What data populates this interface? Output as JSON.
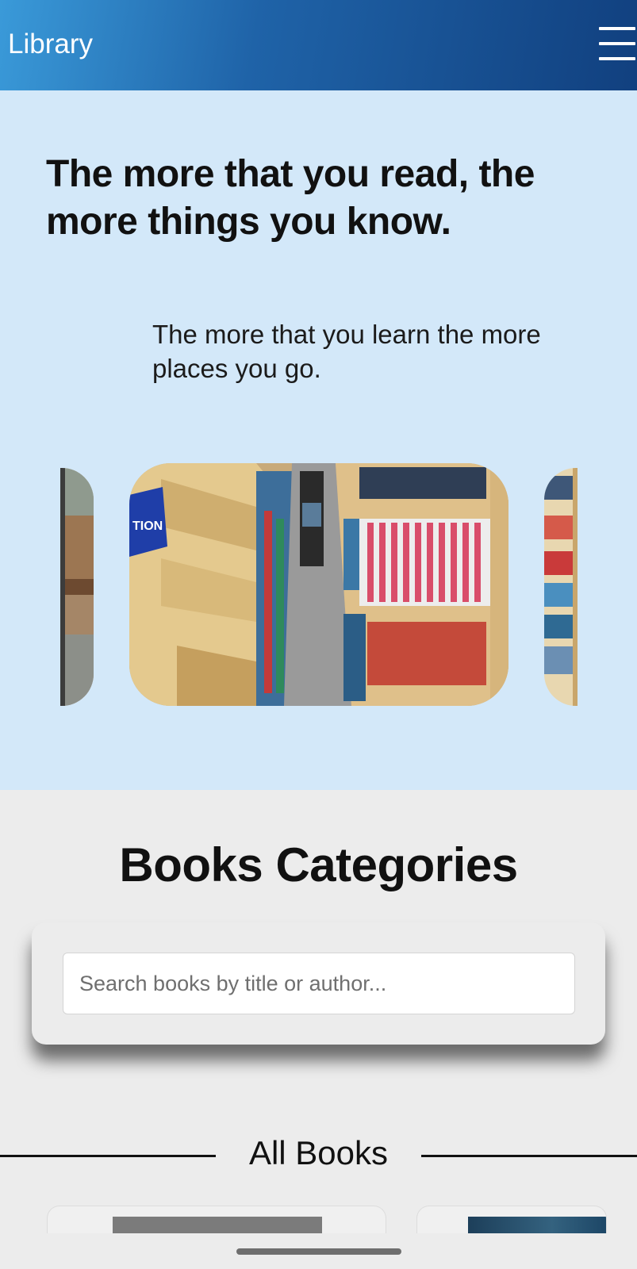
{
  "app": {
    "title": "Library"
  },
  "header": {
    "menu_icon": "hamburger-menu-icon"
  },
  "hero": {
    "headline": "The more that you read, the more things you know.",
    "subline": "The more that you learn the more places you go."
  },
  "carousel": {
    "slides": [
      {
        "position": "previous",
        "image": "library-interior-photo"
      },
      {
        "position": "current",
        "image": "bookshelf-aisle-photo",
        "sign_text": "TION"
      },
      {
        "position": "next",
        "image": "bookshelf-photo"
      }
    ]
  },
  "categories": {
    "title": "Books Categories",
    "search": {
      "placeholder": "Search books by title or author...",
      "value": ""
    }
  },
  "all_books": {
    "title": "All Books"
  },
  "colors": {
    "header_start": "#3a9ad9",
    "header_end": "#11407f",
    "hero_bg": "#d3e8f9",
    "page_bg": "#ececec"
  }
}
